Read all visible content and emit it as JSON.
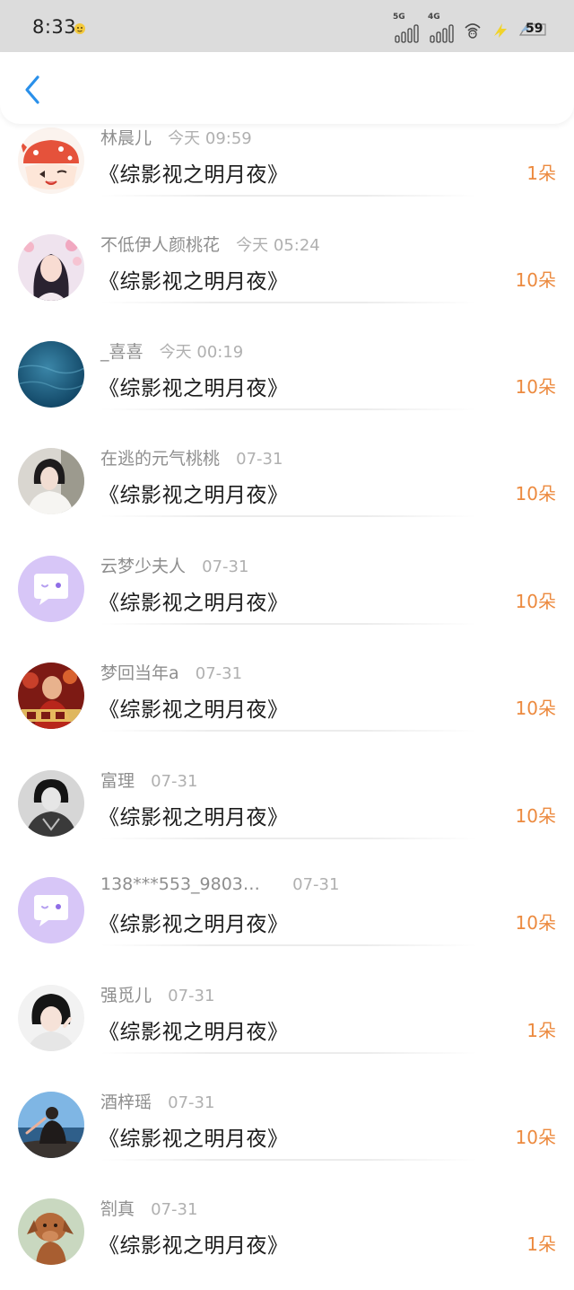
{
  "status_bar": {
    "time": "8:33",
    "network_1": "5G",
    "network_2": "4G",
    "battery": "59"
  },
  "nav": {
    "back_icon": "chevron-left-icon",
    "accent_color": "#2a90ea"
  },
  "list": {
    "items": [
      {
        "name": "林晨儿",
        "time": "今天 09:59",
        "title": "《综影视之明月夜》",
        "count": "1朵",
        "avatar": "bow-character-avatar"
      },
      {
        "name": "不低伊人颜桃花",
        "time": "今天 05:24",
        "title": "《综影视之明月夜》",
        "count": "10朵",
        "avatar": "girl-portrait-avatar"
      },
      {
        "name": "_喜喜",
        "time": "今天 00:19",
        "title": "《综影视之明月夜》",
        "count": "10朵",
        "avatar": "ocean-avatar"
      },
      {
        "name": "在逃的元气桃桃",
        "time": "07-31",
        "title": "《综影视之明月夜》",
        "count": "10朵",
        "avatar": "portrait-avatar"
      },
      {
        "name": "云梦少夫人",
        "time": "07-31",
        "title": "《综影视之明月夜》",
        "count": "10朵",
        "avatar": "default-chat-avatar"
      },
      {
        "name": "梦回当年a",
        "time": "07-31",
        "title": "《综影视之明月夜》",
        "count": "10朵",
        "avatar": "movie-poster-avatar"
      },
      {
        "name": "富理",
        "time": "07-31",
        "title": "《综影视之明月夜》",
        "count": "10朵",
        "avatar": "monochrome-portrait-avatar"
      },
      {
        "name": "138***553_9803…",
        "time": "07-31",
        "title": "《综影视之明月夜》",
        "count": "10朵",
        "avatar": "default-chat-avatar"
      },
      {
        "name": "强觅儿",
        "time": "07-31",
        "title": "《综影视之明月夜》",
        "count": "1朵",
        "avatar": "child-portrait-avatar"
      },
      {
        "name": "酒梓瑶",
        "time": "07-31",
        "title": "《综影视之明月夜》",
        "count": "10朵",
        "avatar": "seaside-photo-avatar"
      },
      {
        "name": "劄真",
        "time": "07-31",
        "title": "《综影视之明月夜》",
        "count": "1朵",
        "avatar": "dog-photo-avatar"
      }
    ]
  },
  "colors": {
    "count": "#ec8a3f",
    "default_avatar_bg": "#d7c6f7"
  }
}
